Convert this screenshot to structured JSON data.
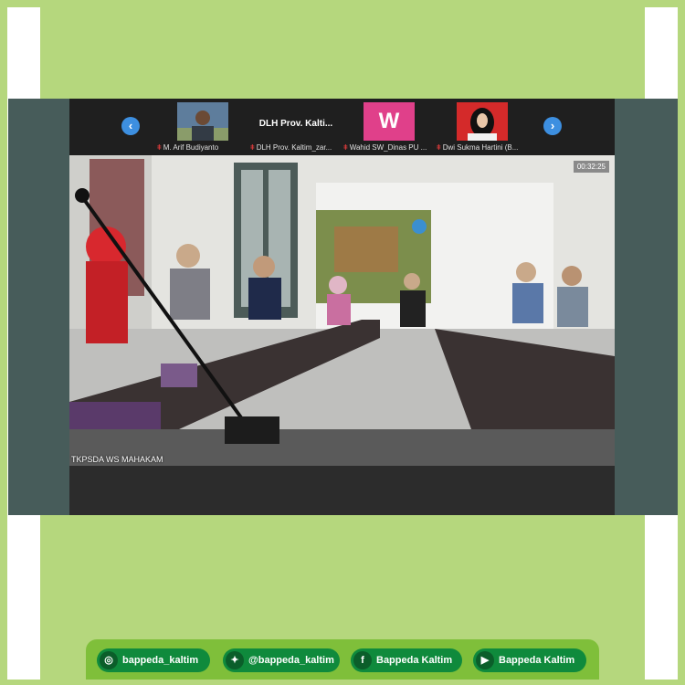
{
  "participants": [
    {
      "name": "M. Arif Budiyanto",
      "title": ""
    },
    {
      "name": "DLH Prov. Kaltim_zar...",
      "title": "DLH Prov. Kalti..."
    },
    {
      "name": "Wahid SW_Dinas PU ...",
      "title": ""
    },
    {
      "name": "Dwi Sukma Hartini (B...",
      "title": ""
    }
  ],
  "wahid_initial": "W",
  "timer": "00:32:25",
  "video_label": "TKPSDA WS MAHAKAM",
  "icons": {
    "prev": "chevron-left-icon",
    "next": "chevron-right-icon",
    "mic": "mic-muted-icon"
  },
  "social": [
    {
      "icon": "instagram-icon",
      "label": "bappeda_kaltim"
    },
    {
      "icon": "twitter-icon",
      "label": "@bappeda_kaltim"
    },
    {
      "icon": "facebook-icon",
      "label": "Bappeda Kaltim"
    },
    {
      "icon": "youtube-icon",
      "label": "Bappeda Kaltim"
    }
  ],
  "colors": {
    "background": "#b5d77d",
    "window": "#475c5a",
    "accent": "#3d8fe0",
    "pill": "#0f8a3c",
    "bar": "#7fbf3a"
  }
}
